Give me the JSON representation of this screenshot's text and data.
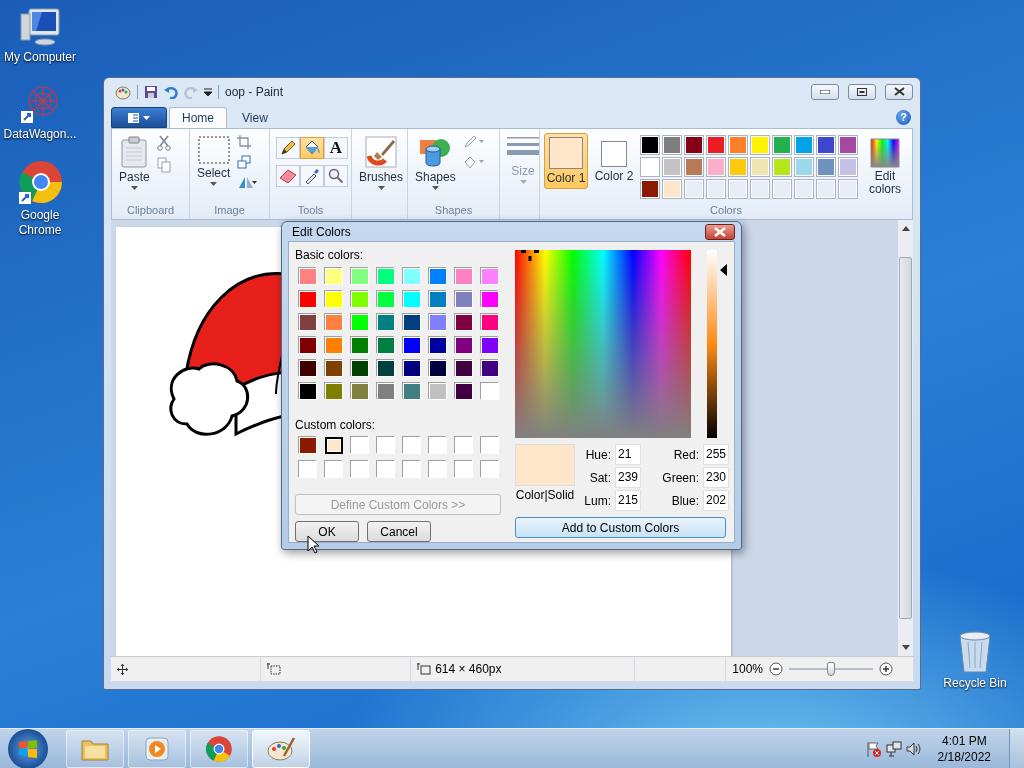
{
  "desktop_icons": [
    {
      "label": "My Computer",
      "kind": "computer"
    },
    {
      "label": "DataWagon...",
      "kind": "web"
    },
    {
      "label": "Google Chrome",
      "kind": "chrome"
    },
    {
      "label": "Recycle Bin",
      "kind": "bin"
    }
  ],
  "paint": {
    "title": "oop - Paint",
    "help": "?",
    "tabs": [
      {
        "label": "Home",
        "selected": true
      },
      {
        "label": "View",
        "selected": false
      }
    ],
    "clipboard": {
      "label": "Clipboard",
      "paste": "Paste"
    },
    "image": {
      "label": "Image",
      "select": "Select"
    },
    "tools": {
      "label": "Tools",
      "items": [
        {
          "kind": "pencil",
          "selected": false
        },
        {
          "kind": "fill",
          "selected": true
        },
        {
          "kind": "text",
          "label": "A",
          "selected": false
        },
        {
          "kind": "eraser",
          "selected": false
        },
        {
          "kind": "picker",
          "selected": false
        },
        {
          "kind": "magnifier",
          "selected": false
        }
      ]
    },
    "brushes": "Brushes",
    "shapes": {
      "label": "Shapes",
      "button": "Shapes"
    },
    "size": {
      "label": "Size",
      "disabled": true
    },
    "colors": {
      "label": "Colors",
      "color1": {
        "label": "Color 1",
        "color": "#ffe6ca",
        "selected": true
      },
      "color2": {
        "label": "Color 2",
        "color": "#ffffff",
        "selected": false
      },
      "palette": [
        [
          {
            "color": "#000000"
          },
          {
            "color": "#7f7f7f"
          },
          {
            "color": "#880015"
          },
          {
            "color": "#ed1c24"
          },
          {
            "color": "#ff7f27"
          },
          {
            "color": "#fff200"
          },
          {
            "color": "#22b14c"
          },
          {
            "color": "#00a2e8"
          },
          {
            "color": "#3f48cc"
          },
          {
            "color": "#a349a4"
          }
        ],
        [
          {
            "color": "#ffffff"
          },
          {
            "color": "#c3c3c3"
          },
          {
            "color": "#b97a57"
          },
          {
            "color": "#ffaec9"
          },
          {
            "color": "#ffc90e"
          },
          {
            "color": "#efe4b0"
          },
          {
            "color": "#b5e61d"
          },
          {
            "color": "#99d9ea"
          },
          {
            "color": "#7092be"
          },
          {
            "color": "#c8bfe7"
          }
        ],
        [
          {
            "color": "#8b1a00"
          },
          {
            "color": "#ffe6ca"
          }
        ]
      ],
      "edit": "Edit colors"
    },
    "status": {
      "size": "614 × 460px",
      "zoom": "100%",
      "zoom_slider": {
        "level": 0.5
      }
    }
  },
  "dialog": {
    "title": "Edit Colors",
    "basic_label": "Basic colors:",
    "basic_colors": [
      {
        "color": "#ff8080"
      },
      {
        "color": "#ffff80"
      },
      {
        "color": "#80ff80"
      },
      {
        "color": "#00ff80"
      },
      {
        "color": "#80ffff"
      },
      {
        "color": "#0080ff"
      },
      {
        "color": "#ff80c0"
      },
      {
        "color": "#ff80ff"
      },
      {
        "color": "#ff0000"
      },
      {
        "color": "#ffff00"
      },
      {
        "color": "#80ff00"
      },
      {
        "color": "#00ff40"
      },
      {
        "color": "#00ffff"
      },
      {
        "color": "#0080c0"
      },
      {
        "color": "#8080c0"
      },
      {
        "color": "#ff00ff"
      },
      {
        "color": "#804040"
      },
      {
        "color": "#ff8040"
      },
      {
        "color": "#00ff00"
      },
      {
        "color": "#008080"
      },
      {
        "color": "#004080"
      },
      {
        "color": "#8080ff"
      },
      {
        "color": "#800040"
      },
      {
        "color": "#ff0080"
      },
      {
        "color": "#800000"
      },
      {
        "color": "#ff8000"
      },
      {
        "color": "#008000"
      },
      {
        "color": "#008040"
      },
      {
        "color": "#0000ff"
      },
      {
        "color": "#0000a0"
      },
      {
        "color": "#800080"
      },
      {
        "color": "#8000ff"
      },
      {
        "color": "#400000"
      },
      {
        "color": "#804000"
      },
      {
        "color": "#004000"
      },
      {
        "color": "#004040"
      },
      {
        "color": "#000080"
      },
      {
        "color": "#000040"
      },
      {
        "color": "#400040"
      },
      {
        "color": "#400080"
      },
      {
        "color": "#000000"
      },
      {
        "color": "#808000"
      },
      {
        "color": "#808040"
      },
      {
        "color": "#808080"
      },
      {
        "color": "#408080"
      },
      {
        "color": "#c0c0c0"
      },
      {
        "color": "#400040"
      },
      {
        "color": "#ffffff"
      }
    ],
    "custom_label": "Custom colors:",
    "custom_colors": [
      {
        "color": "#8b1a00",
        "selected": false
      },
      {
        "color": "#ffe6ca",
        "selected": true
      },
      {
        "color": "#ffffff",
        "selected": false
      },
      {
        "color": "#ffffff",
        "selected": false
      },
      {
        "color": "#ffffff",
        "selected": false
      },
      {
        "color": "#ffffff",
        "selected": false
      },
      {
        "color": "#ffffff",
        "selected": false
      },
      {
        "color": "#ffffff",
        "selected": false
      },
      {
        "color": "#ffffff",
        "selected": false
      },
      {
        "color": "#ffffff",
        "selected": false
      },
      {
        "color": "#ffffff",
        "selected": false
      },
      {
        "color": "#ffffff",
        "selected": false
      },
      {
        "color": "#ffffff",
        "selected": false
      },
      {
        "color": "#ffffff",
        "selected": false
      },
      {
        "color": "#ffffff",
        "selected": false
      },
      {
        "color": "#ffffff",
        "selected": false
      }
    ],
    "define_button": {
      "label": "Define Custom Colors >>",
      "disabled": true
    },
    "ok": "OK",
    "cancel": "Cancel",
    "preview_label": "Color|Solid",
    "fields": [
      {
        "label": "Hue:",
        "value": "21"
      },
      {
        "label": "Sat:",
        "value": "239"
      },
      {
        "label": "Lum:",
        "value": "215"
      },
      {
        "label": "Red:",
        "value": "255"
      },
      {
        "label": "Green:",
        "value": "230"
      },
      {
        "label": "Blue:",
        "value": "202"
      }
    ],
    "add_button": "Add to Custom Colors"
  },
  "taskbar": {
    "apps": [
      {
        "kind": "explorer",
        "selected": false
      },
      {
        "kind": "media",
        "selected": false
      },
      {
        "kind": "chrome",
        "selected": false
      },
      {
        "kind": "paint",
        "selected": true
      }
    ],
    "time": "4:01 PM",
    "date": "2/18/2022"
  }
}
